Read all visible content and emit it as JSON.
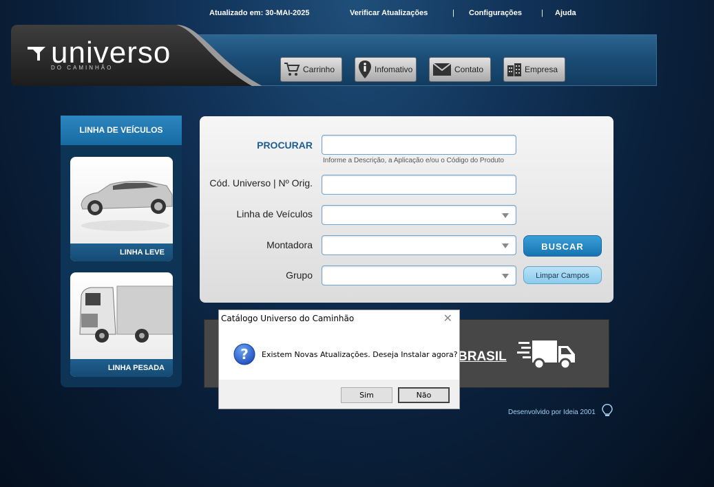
{
  "topbar": {
    "updated": "Atualizado em: 30-MAI-2025",
    "check_updates": "Verificar Atualizações",
    "settings": "Configurações",
    "help": "Ajuda",
    "separator": "|"
  },
  "logo": {
    "name": "universo",
    "subtitle": "DO CAMINHÃO",
    "icon": "logo-mark-icon"
  },
  "nav": {
    "cart": "Carrinho",
    "info": "Infomativo",
    "contact": "Contato",
    "company": "Empresa"
  },
  "sidebar": {
    "title": "LINHA DE VEÍCULOS",
    "items": [
      {
        "label": "LINHA LEVE",
        "icon": "car-image"
      },
      {
        "label": "LINHA PESADA",
        "icon": "truck-image"
      }
    ]
  },
  "search": {
    "procurar_label": "PROCURAR",
    "procurar_hint": "Informe a Descrição, a Aplicação e/ou o Código do Produto",
    "code_label": "Cód. Universo | Nº Orig.",
    "line_label": "Linha de Veículos",
    "maker_label": "Montadora",
    "group_label": "Grupo",
    "search_button": "BUSCAR",
    "clear_button": "Limpar Campos"
  },
  "banner": {
    "text": "BRASIL",
    "icon": "delivery-truck-icon"
  },
  "footer": {
    "credit": "Desenvolvido por Ideia 2001"
  },
  "dialog": {
    "title": "Catálogo Universo do Caminhão",
    "message": "Existem Novas Atualizações. Deseja Instalar agora?",
    "yes": "Sim",
    "no": "Não",
    "icon": "question-icon"
  },
  "colors": {
    "accent": "#1774b2",
    "panel": "#e8e8e8",
    "header_blue": "#1b4d76"
  }
}
